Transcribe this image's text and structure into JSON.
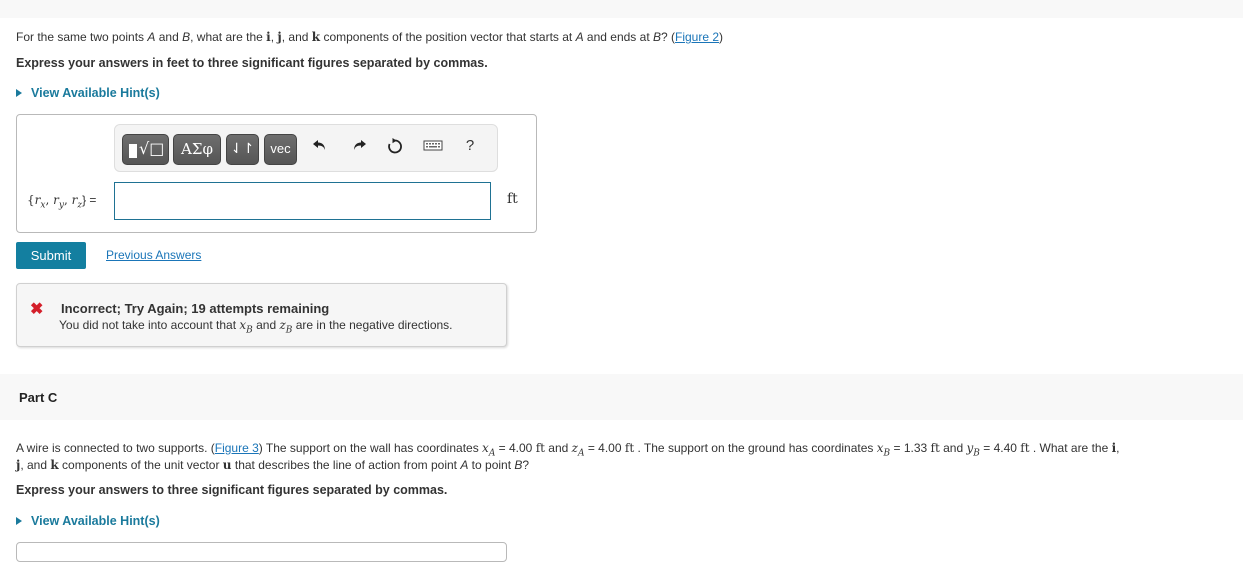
{
  "part_b": {
    "question": {
      "t1": "For the same two points ",
      "A": "A",
      "t2": " and ",
      "B": "B",
      "t3": ", what are the ",
      "i": "i",
      "t4": ", ",
      "j": "j",
      "t5": ", and ",
      "k": "k",
      "t6": " components of the position vector that starts at ",
      "A2": "A",
      "t7": " and ends at ",
      "B2": "B",
      "t8": "? (",
      "figure_link": "Figure 2",
      "t9": ")"
    },
    "instruction": "Express your answers in feet to three significant figures separated by commas.",
    "hint_label": "View Available Hint(s)",
    "toolbar": {
      "templates_label": "√□",
      "greek_label": "ΑΣφ",
      "arrows_label": "⇃↾",
      "vec_label": "vec",
      "undo_icon": "↶",
      "redo_icon": "↷",
      "reset_icon": "↻",
      "keyboard_icon": "⌨",
      "help_label": "?"
    },
    "answer": {
      "label_open": "{",
      "rx": "r",
      "rx_sub": "x",
      "ry": "r",
      "ry_sub": "y",
      "rz": "r",
      "rz_sub": "z",
      "label_close": "} =",
      "value": "",
      "unit": "ft"
    },
    "submit_label": "Submit",
    "previous_answers_label": "Previous Answers",
    "feedback": {
      "icon": "✖",
      "title": "Incorrect; Try Again; 19 attempts remaining",
      "m1": "You did not take into account that ",
      "xB": "x",
      "xB_sub": "B",
      "m2": " and ",
      "zB": "z",
      "zB_sub": "B",
      "m3": " are in the negative directions."
    }
  },
  "part_c": {
    "title": "Part C",
    "question": {
      "t1": "A wire is connected to two supports. (",
      "figure_link": "Figure 3",
      "t2": ") The support on the wall has coordinates ",
      "xA": "x",
      "xA_sub": "A",
      "t3": " = 4.00 ",
      "u1": "ft",
      "t4": " and ",
      "zA": "z",
      "zA_sub": "A",
      "t5": " = 4.00 ",
      "u2": "ft",
      "t6": " . The support on the ground has coordinates ",
      "xB": "x",
      "xB_sub": "B",
      "t7": " = 1.33 ",
      "u3": "ft",
      "t8": " and ",
      "yB": "y",
      "yB_sub": "B",
      "t9": " = 4.40 ",
      "u4": "ft",
      "t10": " . What are the ",
      "i": "i",
      "t11": ",",
      "j": "j",
      "t12": ", and ",
      "k": "k",
      "t13": " components of the unit vector ",
      "u": "u",
      "t14": " that describes the line of action from point ",
      "A": "A",
      "t15": " to point ",
      "B": "B",
      "t16": "?"
    },
    "instruction": "Express your answers to three significant figures separated by commas.",
    "hint_label": "View Available Hint(s)"
  },
  "colors": {
    "accent": "#137fa0",
    "link": "#1a75b8",
    "hint": "#1a7a9c",
    "error": "#d41f2a",
    "band": "#f8f8f8"
  }
}
